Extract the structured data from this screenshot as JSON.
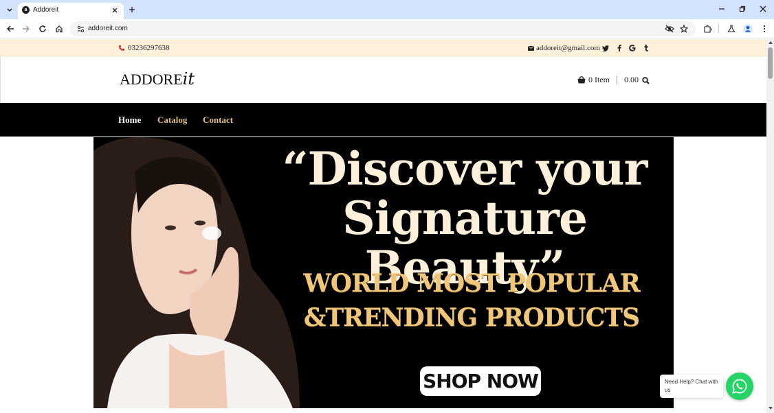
{
  "browser": {
    "tab_title": "Addoreit",
    "favicon_letter": "a",
    "url": "addoreit.com"
  },
  "site": {
    "phone": "03236297638",
    "email": "addoreit@gmail.com",
    "logo_text": "ADDORE",
    "logo_script": "it",
    "cart_label": "0 Item",
    "cart_total": "0.00",
    "menu": [
      {
        "label": "Home",
        "color": "#ffffff"
      },
      {
        "label": "Catalog",
        "color": "#e3c28a"
      },
      {
        "label": "Contact",
        "color": "#e3c28a"
      }
    ],
    "banner": {
      "headline_line1": "“Discover your",
      "headline_line2": "Signature Beauty”",
      "subline_line1": "WORLD MOST POPULAR",
      "subline_line2": "&TRENDING PRODUCTS",
      "cta": "SHOP NOW"
    },
    "chat": {
      "text": "Need Help? Chat with us"
    }
  },
  "colors": {
    "topbar_bg": "#fdf0db",
    "menu_bg": "#000000",
    "accent_gold": "#e3c28a",
    "whatsapp_green": "#25d366"
  },
  "icons": [
    "tab-list-icon",
    "close-icon",
    "plus-icon",
    "minimize-icon",
    "restore-icon",
    "back-icon",
    "forward-icon",
    "reload-icon",
    "home-icon",
    "site-info-icon",
    "eye-off-icon",
    "star-icon",
    "extensions-icon",
    "labs-icon",
    "profile-icon",
    "kebab-menu-icon",
    "phone-icon",
    "envelope-icon",
    "twitter-icon",
    "facebook-icon",
    "google-icon",
    "tumblr-icon",
    "cart-icon",
    "search-icon",
    "whatsapp-icon"
  ]
}
